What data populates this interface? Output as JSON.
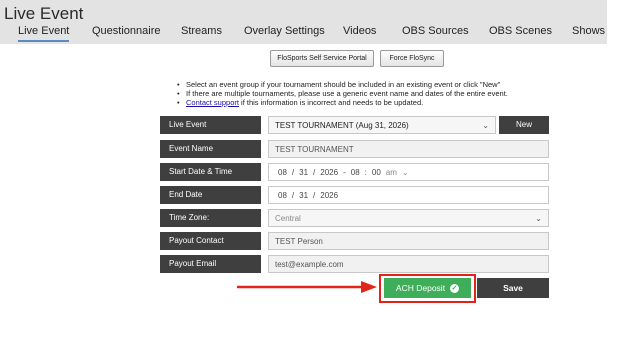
{
  "app": {
    "title": "Live Event"
  },
  "tabs": [
    {
      "label": "Live Event",
      "active": true
    },
    {
      "label": "Questionnaire"
    },
    {
      "label": "Streams"
    },
    {
      "label": "Overlay Settings"
    },
    {
      "label": "Videos"
    },
    {
      "label": "OBS Sources"
    },
    {
      "label": "OBS Scenes"
    },
    {
      "label": "Shows"
    }
  ],
  "toolbar": {
    "portal_label": "FloSports Self Service Portal",
    "sync_label": "Force FloSync"
  },
  "info": {
    "line1": "Select an event group if your tournament should be included in an existing event or click \"New\"",
    "line2": "If there are multiple tournaments, please use a generic event name and dates of the entire event.",
    "line3_link": "Contact support",
    "line3_rest": " if this information is incorrect and needs to be updated."
  },
  "form": {
    "live_event": {
      "label": "Live Event",
      "value": "TEST TOURNAMENT (Aug 31, 2026)",
      "new_label": "New"
    },
    "event_name": {
      "label": "Event Name",
      "value": "TEST TOURNAMENT"
    },
    "start": {
      "label": "Start Date & Time",
      "month": "08",
      "day": "31",
      "year": "2026",
      "hour": "08",
      "minute": "00",
      "ampm": "am",
      "sep_slash": "/",
      "sep_dash": "-",
      "sep_colon": ":"
    },
    "end": {
      "label": "End Date",
      "month": "08",
      "day": "31",
      "year": "2026",
      "sep_slash": "/"
    },
    "timezone": {
      "label": "Time Zone:",
      "value": "Central"
    },
    "payout_contact": {
      "label": "Payout Contact",
      "value": "TEST Person"
    },
    "payout_email": {
      "label": "Payout Email",
      "value": "test@example.com"
    }
  },
  "actions": {
    "ach_label": "ACH Deposit",
    "save_label": "Save"
  },
  "colors": {
    "accent_green": "#3fae5a",
    "highlight_red": "#e2231a",
    "dark_label": "#3f3f3f"
  },
  "icons": {
    "check": "check-circle-icon",
    "chevron": "chevron-down-icon",
    "arrow": "arrow-right-icon"
  }
}
